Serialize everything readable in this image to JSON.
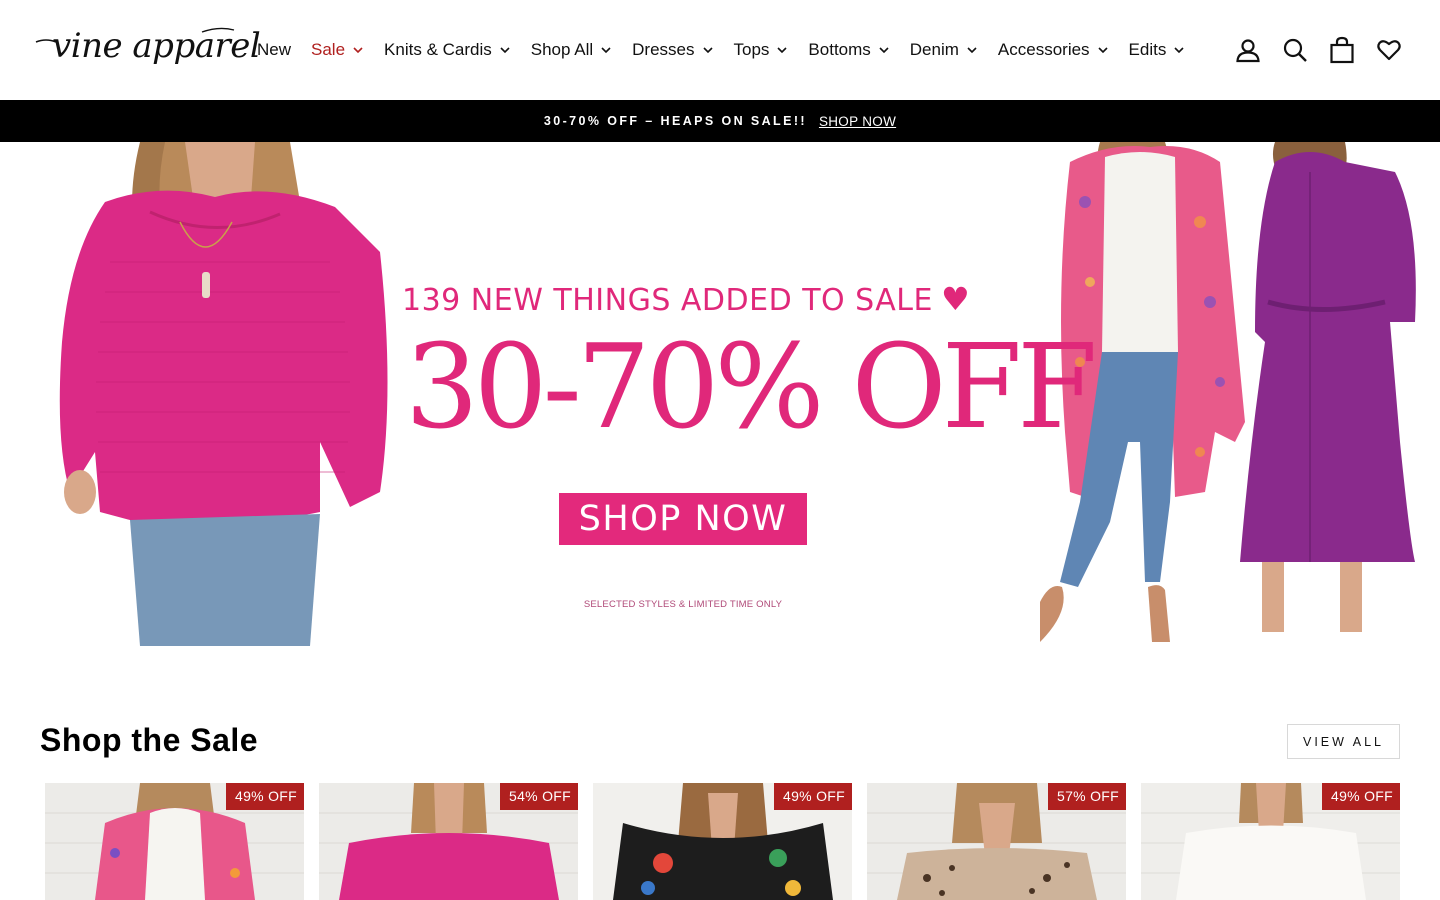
{
  "brand": {
    "logo_text": "vine apparel"
  },
  "nav": {
    "items": [
      {
        "label": "New",
        "has_dropdown": false
      },
      {
        "label": "Sale",
        "has_dropdown": true,
        "highlight": true
      },
      {
        "label": "Knits & Cardis",
        "has_dropdown": true
      },
      {
        "label": "Shop All",
        "has_dropdown": true
      },
      {
        "label": "Dresses",
        "has_dropdown": true
      },
      {
        "label": "Tops",
        "has_dropdown": true
      },
      {
        "label": "Bottoms",
        "has_dropdown": true
      },
      {
        "label": "Denim",
        "has_dropdown": true
      },
      {
        "label": "Accessories",
        "has_dropdown": true
      },
      {
        "label": "Edits",
        "has_dropdown": true
      }
    ],
    "icons": [
      "account-icon",
      "search-icon",
      "cart-icon",
      "wishlist-heart-icon"
    ]
  },
  "announcement": {
    "text": "30-70% OFF – HEAPS ON SALE!!",
    "link": "SHOP NOW"
  },
  "hero": {
    "headline": "139 NEW THINGS ADDED TO SALE",
    "discount": "30-70% OFF",
    "button": "SHOP NOW",
    "fine_print": "SELECTED STYLES & LIMITED TIME ONLY"
  },
  "sale_section": {
    "title": "Shop the Sale",
    "view_all": "VIEW ALL",
    "products": [
      {
        "badge": "49% OFF"
      },
      {
        "badge": "54% OFF"
      },
      {
        "badge": "49% OFF"
      },
      {
        "badge": "57% OFF"
      },
      {
        "badge": "49% OFF"
      }
    ]
  },
  "colors": {
    "sale_red": "#b0201f",
    "hero_pink": "#e0287a",
    "announcement_bg": "#000000"
  }
}
